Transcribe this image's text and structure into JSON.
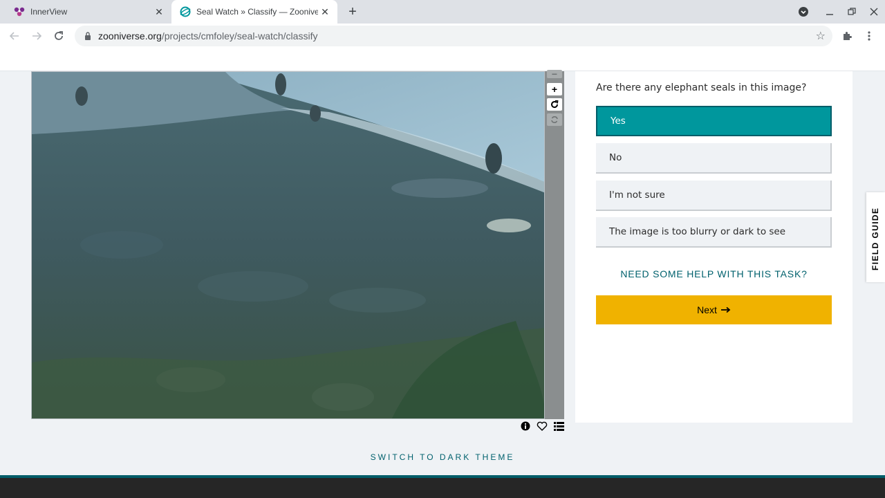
{
  "browser": {
    "tabs": [
      {
        "title": "InnerView",
        "active": false
      },
      {
        "title": "Seal Watch » Classify — Zooniverse",
        "active": true
      }
    ],
    "url_host": "zooniverse.org",
    "url_path": "/projects/cmfoley/seal-watch/classify"
  },
  "task": {
    "question": "Are there any elephant seals in this image?",
    "answers": [
      {
        "label": "Yes",
        "selected": true
      },
      {
        "label": "No",
        "selected": false
      },
      {
        "label": "I'm not sure",
        "selected": false
      },
      {
        "label": "The image is too blurry or dark to see",
        "selected": false
      }
    ],
    "help_link": "NEED SOME HELP WITH THIS TASK?",
    "next_label": "Next"
  },
  "field_guide_label": "FIELD GUIDE",
  "theme_toggle": "SWITCH TO DARK THEME",
  "colors": {
    "selected_answer": "#00979d",
    "next_button": "#f0b200",
    "link_teal": "#00616d",
    "footer": "#262626"
  }
}
